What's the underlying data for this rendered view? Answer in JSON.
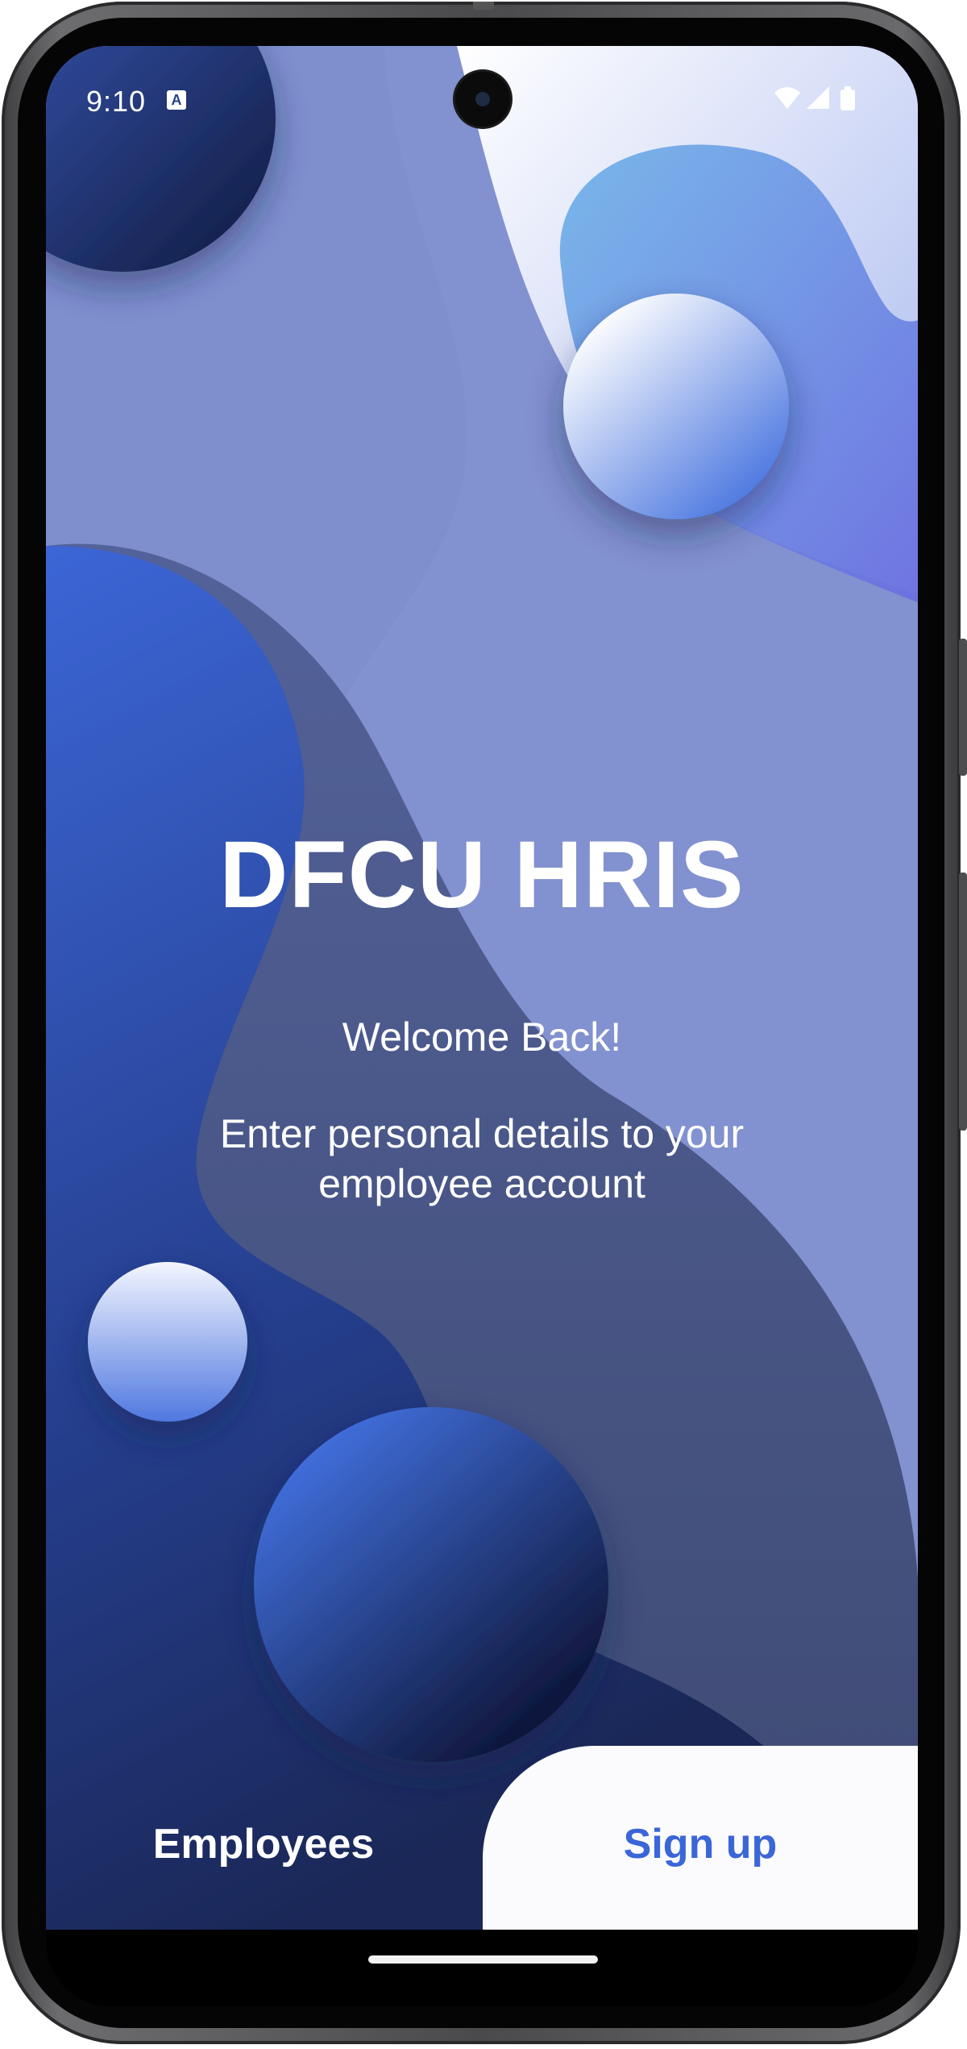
{
  "status_bar": {
    "time": "9:10",
    "notification_icon": "accessibility-a-icon",
    "icons": [
      "wifi-icon",
      "cellular-signal-icon",
      "battery-icon"
    ]
  },
  "app": {
    "title": "DFCU HRIS",
    "welcome": "Welcome Back!",
    "subtitle": "Enter personal details to your employee account"
  },
  "tabs": {
    "employees_label": "Employees",
    "signup_label": "Sign up"
  },
  "colors": {
    "accent": "#3b66d8",
    "background": "#7f8fce",
    "dark_blue": "#1e2b5e"
  }
}
